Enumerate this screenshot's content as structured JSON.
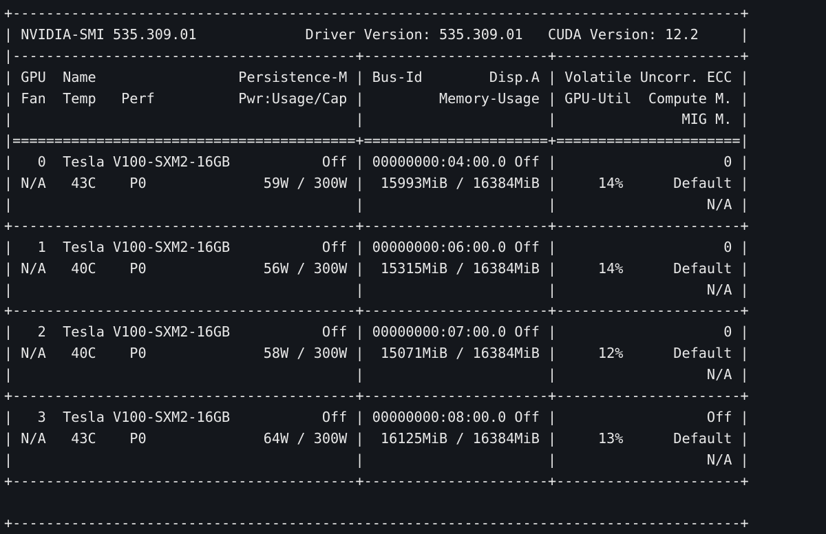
{
  "terminal": {
    "border_top": "+---------------------------------------------------------------------------------------+",
    "header_row": "| NVIDIA-SMI 535.309.01             Driver Version: 535.309.01   CUDA Version: 12.2     |",
    "header_separator": "|-----------------------------------------+----------------------+----------------------+",
    "column_headers": [
      "| GPU  Name                 Persistence-M | Bus-Id        Disp.A | Volatile Uncorr. ECC |",
      "| Fan  Temp   Perf          Pwr:Usage/Cap |         Memory-Usage | GPU-Util  Compute M. |",
      "|                                         |                      |               MIG M. |"
    ],
    "header_double_rule": "|=========================================+======================+======================|",
    "gpus": [
      {
        "lines": [
          "|   0  Tesla V100-SXM2-16GB           Off | 00000000:04:00.0 Off |                    0 |",
          "| N/A   43C    P0              59W / 300W |  15993MiB / 16384MiB |     14%      Default |",
          "|                                         |                      |                  N/A |"
        ],
        "separator": "+-----------------------------------------+----------------------+----------------------+"
      },
      {
        "lines": [
          "|   1  Tesla V100-SXM2-16GB           Off | 00000000:06:00.0 Off |                    0 |",
          "| N/A   40C    P0              56W / 300W |  15315MiB / 16384MiB |     14%      Default |",
          "|                                         |                      |                  N/A |"
        ],
        "separator": "+-----------------------------------------+----------------------+----------------------+"
      },
      {
        "lines": [
          "|   2  Tesla V100-SXM2-16GB           Off | 00000000:07:00.0 Off |                    0 |",
          "| N/A   40C    P0              58W / 300W |  15071MiB / 16384MiB |     12%      Default |",
          "|                                         |                      |                  N/A |"
        ],
        "separator": "+-----------------------------------------+----------------------+----------------------+"
      },
      {
        "lines": [
          "|   3  Tesla V100-SXM2-16GB           Off | 00000000:08:00.0 Off |                  Off |",
          "| N/A   43C    P0              64W / 300W |  16125MiB / 16384MiB |     13%      Default |",
          "|                                         |                      |                  N/A |"
        ],
        "separator": "+-----------------------------------------+----------------------+----------------------+"
      }
    ],
    "border_bottom": "+---------------------------------------------------------------------------------------+"
  }
}
